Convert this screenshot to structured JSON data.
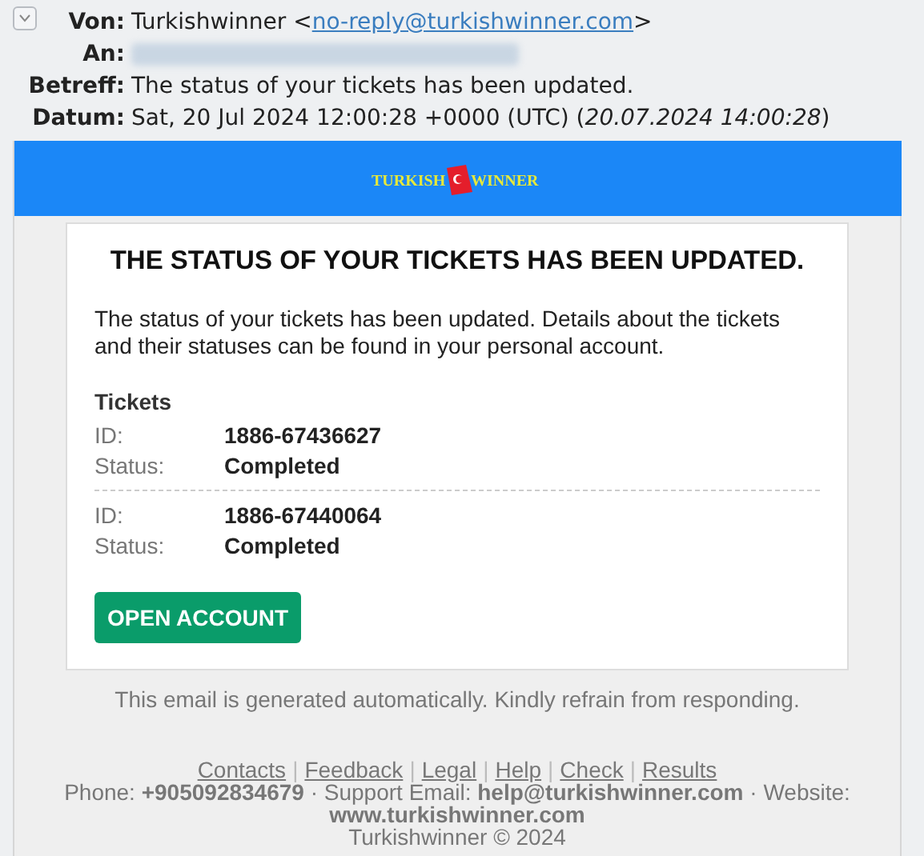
{
  "headers": [
    {
      "label": "Von:",
      "kind": "sender",
      "name": "Turkishwinner <",
      "address": "no-reply@turkishwinner.com",
      "after": ">"
    },
    {
      "label": "An:",
      "kind": "redacted"
    },
    {
      "label": "Betreff:",
      "kind": "plain",
      "value": "The status of your tickets has been updated."
    },
    {
      "label": "Datum:",
      "kind": "date",
      "value": "Sat, 20 Jul 2024 12:00:28 +0000 (UTC) (*20.07.2024 14:00:28*)"
    }
  ],
  "banner": {
    "logo_left": "TURKISH",
    "logo_right": "WINNER"
  },
  "card": {
    "title": "THE STATUS OF YOUR TICKETS HAS BEEN UPDATED.",
    "intro": "The status of your tickets has been updated. Details about the tickets and their statuses can be found in your personal account.",
    "section": "Tickets",
    "tickets": [
      {
        "id_label": "ID:",
        "id": "1886-67436627",
        "status_label": "Status:",
        "status": "Completed"
      },
      {
        "id_label": "ID:",
        "id": "1886-67440064",
        "status_label": "Status:",
        "status": "Completed"
      }
    ],
    "button": "OPEN ACCOUNT"
  },
  "notice": "This email is generated automatically. Kindly refrain from responding.",
  "footer": {
    "separator": "|",
    "links": [
      "Contacts",
      "Feedback",
      "Legal",
      "Help",
      "Check",
      "Results"
    ],
    "contact": "Phone: **+905092834679** · Support Email: **help@turkishwinner.com** · Website: **www.turkishwinner.com**",
    "copyright": "Turkishwinner © 2024"
  }
}
